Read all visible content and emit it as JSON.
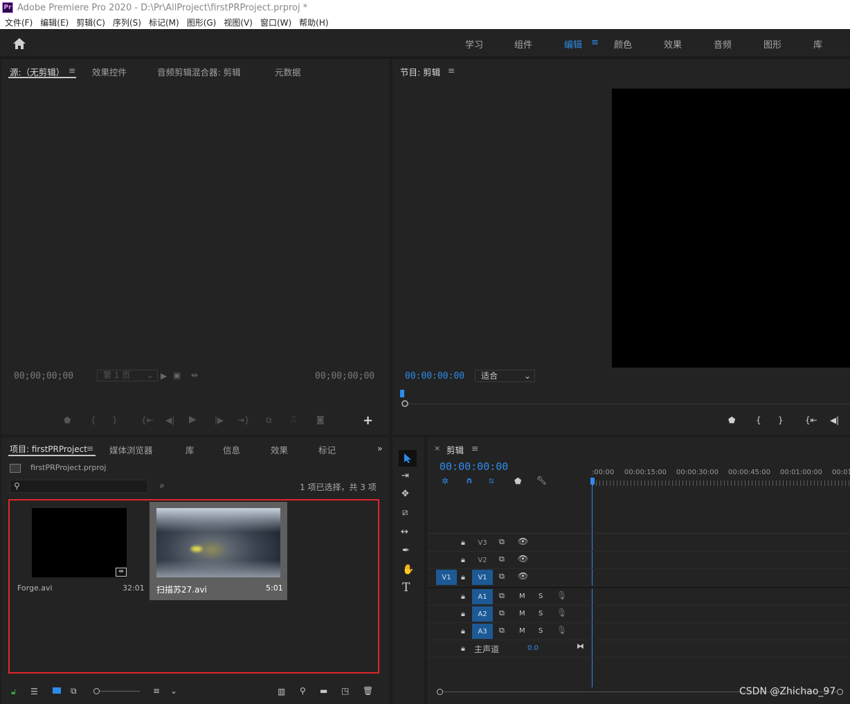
{
  "titlebar": {
    "title": "Adobe Premiere Pro 2020 - D:\\Pr\\AllProject\\firstPRProject.prproj *",
    "logo": "Pr"
  },
  "menubar": {
    "items": [
      "文件(F)",
      "编辑(E)",
      "剪辑(C)",
      "序列(S)",
      "标记(M)",
      "图形(G)",
      "视图(V)",
      "窗口(W)",
      "帮助(H)"
    ]
  },
  "workspaces": {
    "items": [
      "学习",
      "组件",
      "编辑",
      "颜色",
      "效果",
      "音频",
      "图形",
      "库"
    ],
    "active": "编辑",
    "menu_glyph": "≡"
  },
  "source_panel": {
    "tabs": [
      "源:（无剪辑）",
      "效果控件",
      "音频剪辑混合器: 剪辑",
      "元数据"
    ],
    "menu_glyph": "≡",
    "timecode_left": "00;00;00;00",
    "timecode_right": "00;00;00;00",
    "page_label": "第 1 页",
    "add_glyph": "+"
  },
  "program_panel": {
    "title": "节目: 剪辑",
    "menu_glyph": "≡",
    "timecode": "00:00:00:00",
    "fit_label": "适合"
  },
  "project_panel": {
    "tabs": [
      "项目: firstPRProject",
      "媒体浏览器",
      "库",
      "信息",
      "效果",
      "标记"
    ],
    "menu_glyph": "≡",
    "overflow_glyph": "»",
    "file_name": "firstPRProject.prproj",
    "selection_info": "1 项已选择，共 3 项",
    "items": [
      {
        "name": "Forge.avi",
        "duration": "32:01"
      },
      {
        "name": "扫描苏27.avi",
        "duration": "5:01"
      }
    ]
  },
  "timeline_panel": {
    "close_glyph": "×",
    "title": "剪辑",
    "menu_glyph": "≡",
    "timecode": "00:00:00:00",
    "ruler": [
      ":00:00",
      "00:00:15:00",
      "00:00:30:00",
      "00:00:45:00",
      "00:01:00:00",
      "00:01"
    ],
    "video_tracks": [
      "V3",
      "V2",
      "V1"
    ],
    "source_patch": "V1",
    "audio_tracks": [
      "A1",
      "A2",
      "A3"
    ],
    "mute_label": "M",
    "solo_label": "S",
    "master_label": "主声道",
    "master_value": "0.0"
  },
  "watermark": "CSDN @Zhichao_97",
  "colors": {
    "accent": "#2d8ceb",
    "selection_border": "#e0262b",
    "track_selected": "#1d5a95",
    "panel": "#232323"
  }
}
